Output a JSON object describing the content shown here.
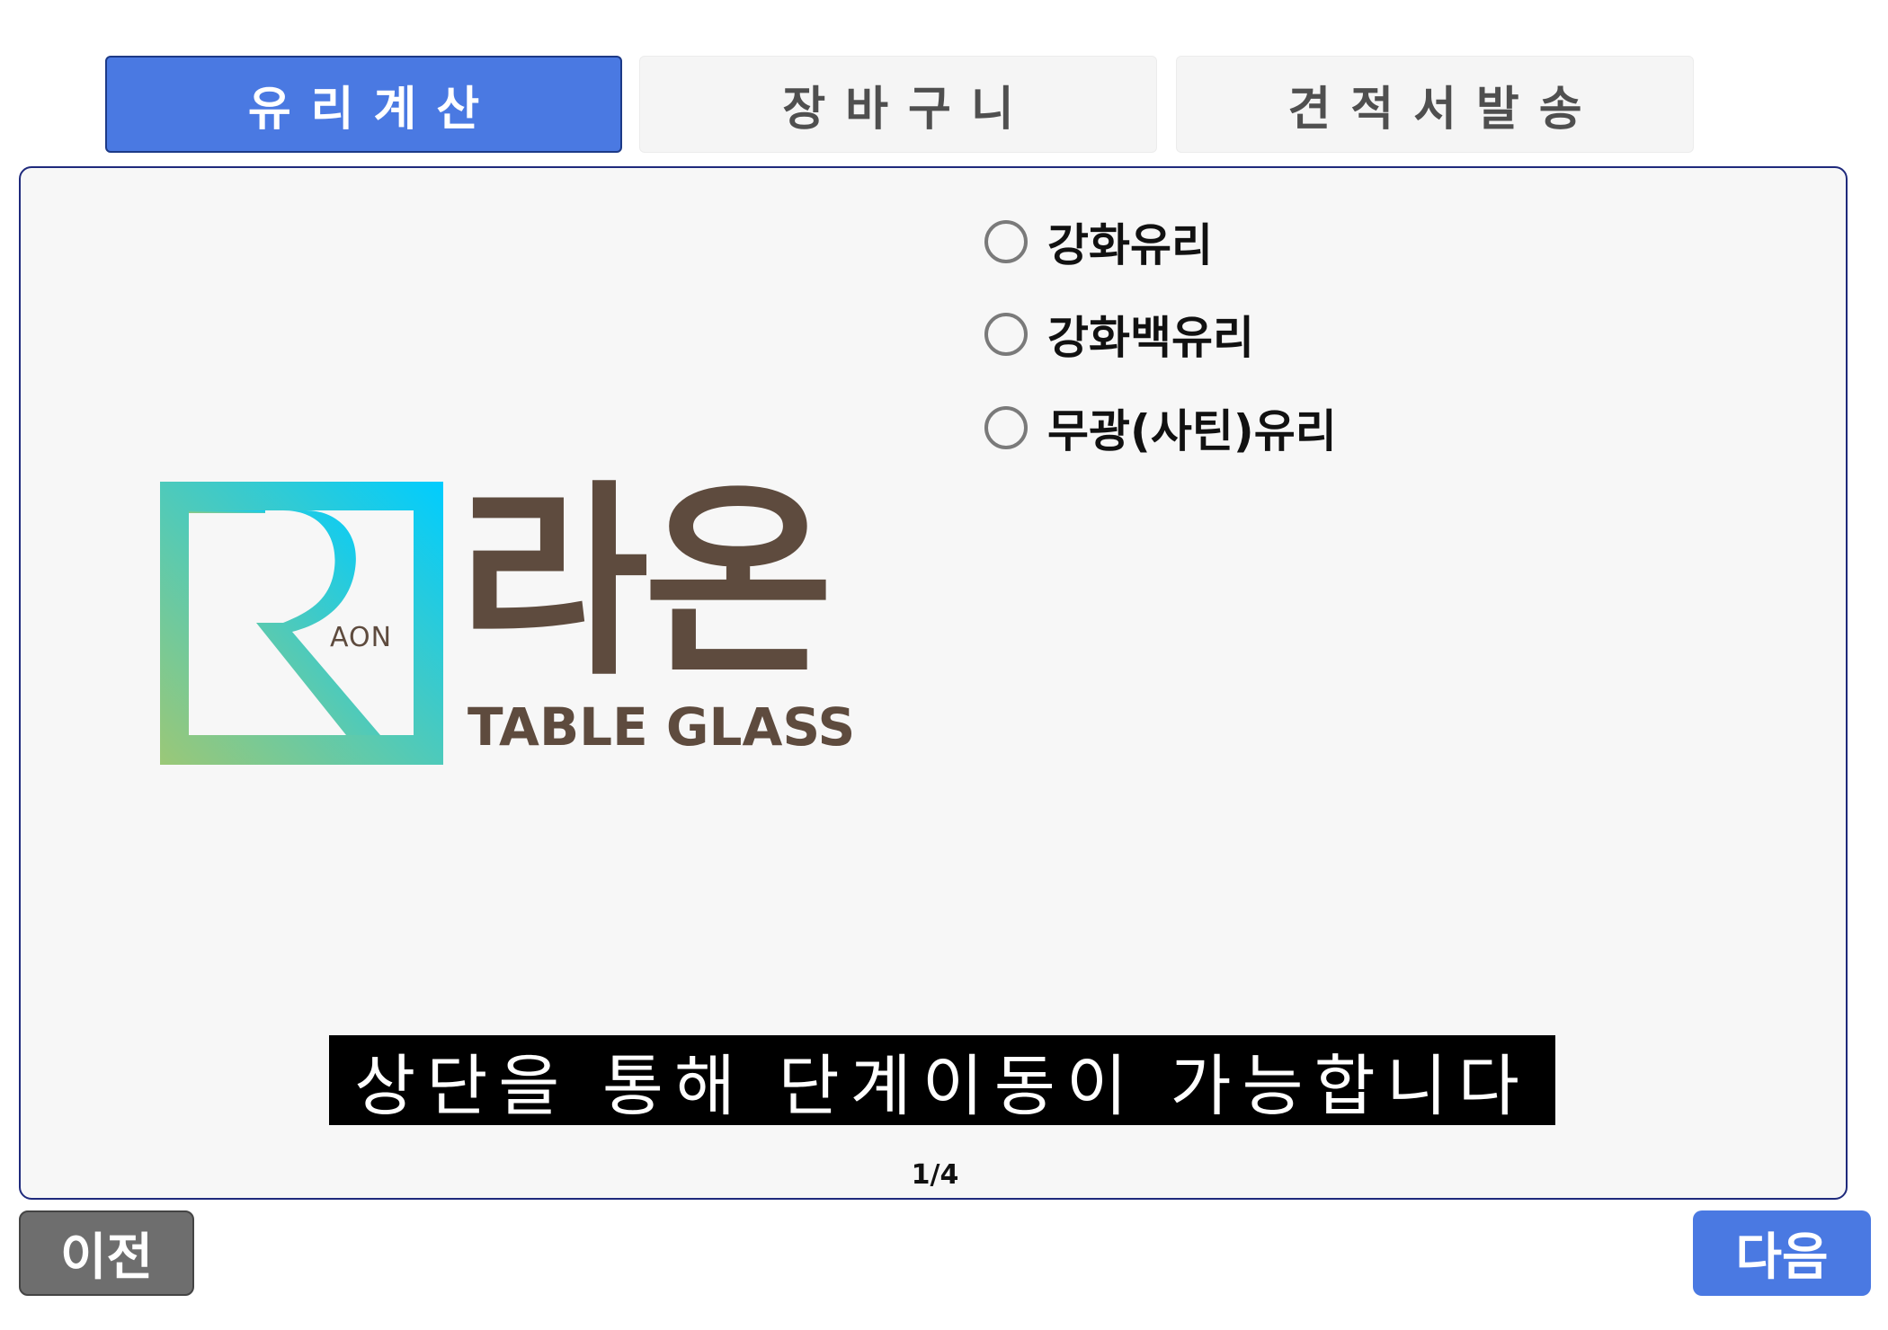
{
  "tabs": [
    {
      "label": "유리계산",
      "active": true
    },
    {
      "label": "장바구니",
      "active": false
    },
    {
      "label": "견적서발송",
      "active": false
    }
  ],
  "glass_options": [
    {
      "label": "강화유리",
      "selected": false
    },
    {
      "label": "강화백유리",
      "selected": false
    },
    {
      "label": "무광(사틴)유리",
      "selected": false
    }
  ],
  "logo": {
    "name": "라온",
    "subtitle": "TABLE GLASS",
    "mark_text": "AON"
  },
  "banner": {
    "text": "상단을 통해 단계이동이 가능합니다"
  },
  "pager": {
    "text": "1/4"
  },
  "nav": {
    "prev_label": "이전",
    "next_label": "다음"
  },
  "colors": {
    "accent": "#4a79e2",
    "logo_brown": "#5e4b3e",
    "logo_gradient": [
      "#9bc877",
      "#00ccff"
    ]
  }
}
